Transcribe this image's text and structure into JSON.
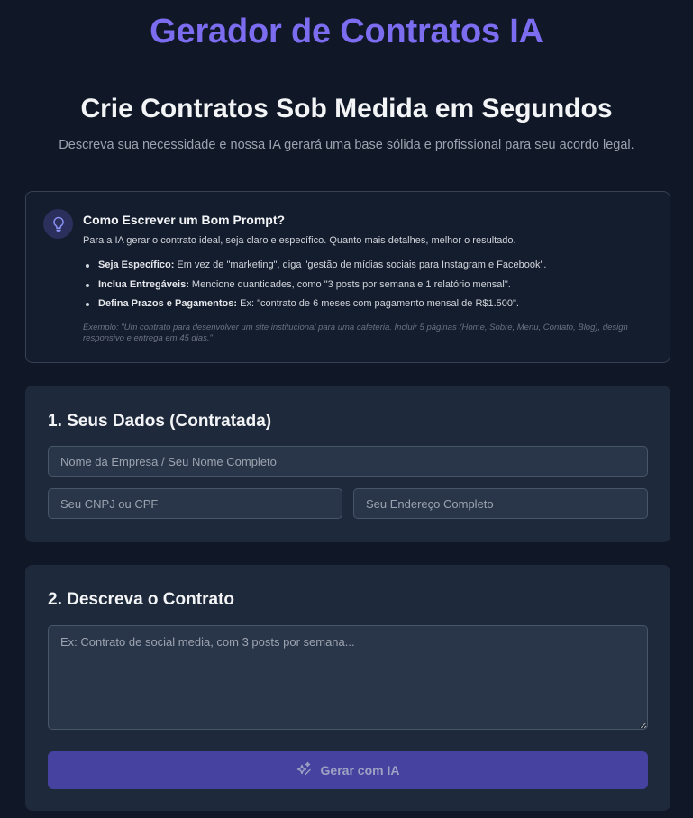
{
  "header": {
    "title": "Gerador de Contratos IA"
  },
  "hero": {
    "title": "Crie Contratos Sob Medida em Segundos",
    "subtitle": "Descreva sua necessidade e nossa IA gerará uma base sólida e profissional para seu acordo legal."
  },
  "tips": {
    "icon": "lightbulb-icon",
    "title": "Como Escrever um Bom Prompt?",
    "description": "Para a IA gerar o contrato ideal, seja claro e específico. Quanto mais detalhes, melhor o resultado.",
    "items": [
      {
        "label": "Seja Específico:",
        "text": " Em vez de \"marketing\", diga \"gestão de mídias sociais para Instagram e Facebook\"."
      },
      {
        "label": "Inclua Entregáveis:",
        "text": " Mencione quantidades, como \"3 posts por semana e 1 relatório mensal\"."
      },
      {
        "label": "Defina Prazos e Pagamentos:",
        "text": " Ex: \"contrato de 6 meses com pagamento mensal de R$1.500\"."
      }
    ],
    "example": "Exemplo: \"Um contrato para desenvolver um site institucional para uma cafeteria. Incluir 5 páginas (Home, Sobre, Menu, Contato, Blog), design responsivo e entrega em 45 dias.\""
  },
  "section1": {
    "title": "1. Seus Dados (Contratada)",
    "name_placeholder": "Nome da Empresa / Seu Nome Completo",
    "name_value": "",
    "doc_placeholder": "Seu CNPJ ou CPF",
    "doc_value": "",
    "address_placeholder": "Seu Endereço Completo",
    "address_value": ""
  },
  "section2": {
    "title": "2. Descreva o Contrato",
    "description_placeholder": "Ex: Contrato de social media, com 3 posts por semana...",
    "description_value": "",
    "generate_label": "Gerar com IA",
    "generate_icon": "sparkles-icon"
  },
  "colors": {
    "background": "#101828",
    "accent": "#7c6cf0",
    "card": "#1e293b",
    "button": "#4642a0"
  }
}
